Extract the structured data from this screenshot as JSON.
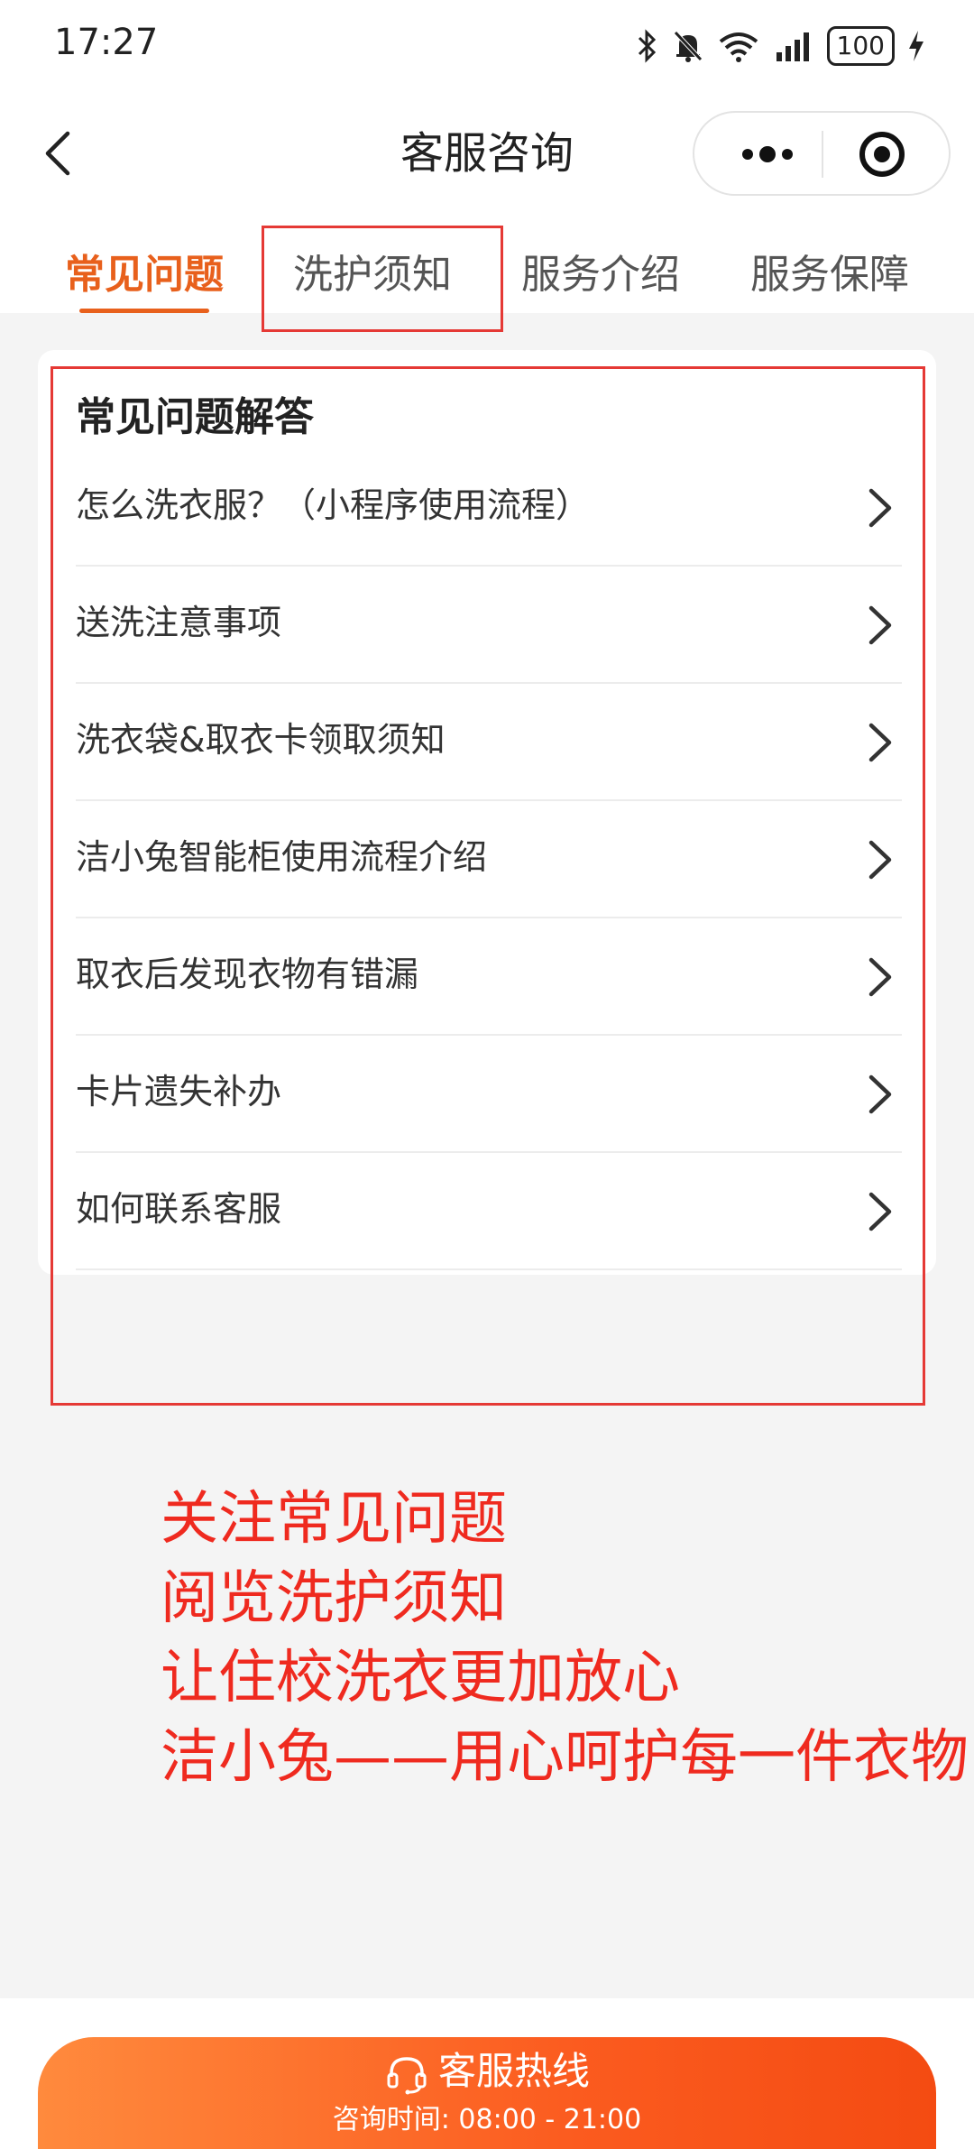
{
  "status_bar": {
    "time": "17:27",
    "battery": "100"
  },
  "nav": {
    "title": "客服咨询"
  },
  "tabs": [
    {
      "label": "常见问题",
      "active": true
    },
    {
      "label": "洗护须知",
      "active": false
    },
    {
      "label": "服务介绍",
      "active": false
    },
    {
      "label": "服务保障",
      "active": false
    }
  ],
  "faq": {
    "heading": "常见问题解答",
    "items": [
      {
        "label": "怎么洗衣服？（小程序使用流程）"
      },
      {
        "label": "送洗注意事项"
      },
      {
        "label": "洗衣袋&取衣卡领取须知"
      },
      {
        "label": "洁小兔智能柜使用流程介绍"
      },
      {
        "label": "取衣后发现衣物有错漏"
      },
      {
        "label": "卡片遗失补办"
      },
      {
        "label": "如何联系客服"
      }
    ]
  },
  "promo": {
    "lines": [
      "关注常见问题",
      "阅览洗护须知",
      "让住校洗衣更加放心",
      "洁小兔——用心呵护每一件衣物"
    ]
  },
  "hotline": {
    "label": "客服热线",
    "hours": "咨询时间: 08:00 - 21:00"
  },
  "icons": {
    "status": [
      "bluetooth-icon",
      "bell-muted-icon",
      "wifi-icon",
      "signal-icon",
      "battery-icon",
      "charging-icon"
    ],
    "nav": [
      "back-arrow-icon",
      "more-dots-icon",
      "close-target-icon"
    ],
    "list": "chevron-right-icon",
    "hotline": "headset-icon"
  },
  "colors": {
    "accent": "#e8601c",
    "annotation_red": "#e53935",
    "promo_red": "#ef2a1f",
    "button_gradient_start": "#ff8a3d",
    "button_gradient_end": "#f44b12"
  }
}
